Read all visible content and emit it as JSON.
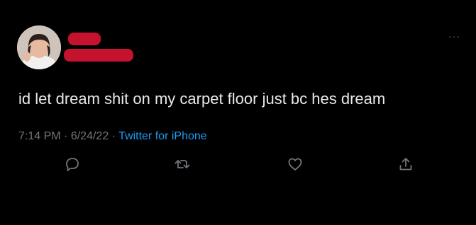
{
  "tweet": {
    "body": "id let dream shit on my carpet floor just bc hes dream",
    "time": "7:14 PM",
    "separator1": "·",
    "date": "6/24/22",
    "separator2": "·",
    "source": "Twitter for iPhone",
    "more_glyph": "···"
  },
  "colors": {
    "background": "#000000",
    "text": "#e7e9ea",
    "muted": "#71767b",
    "link": "#1d9bf0",
    "redaction": "#c4122f"
  },
  "icons": [
    "reply-icon",
    "retweet-icon",
    "like-icon",
    "share-icon"
  ]
}
